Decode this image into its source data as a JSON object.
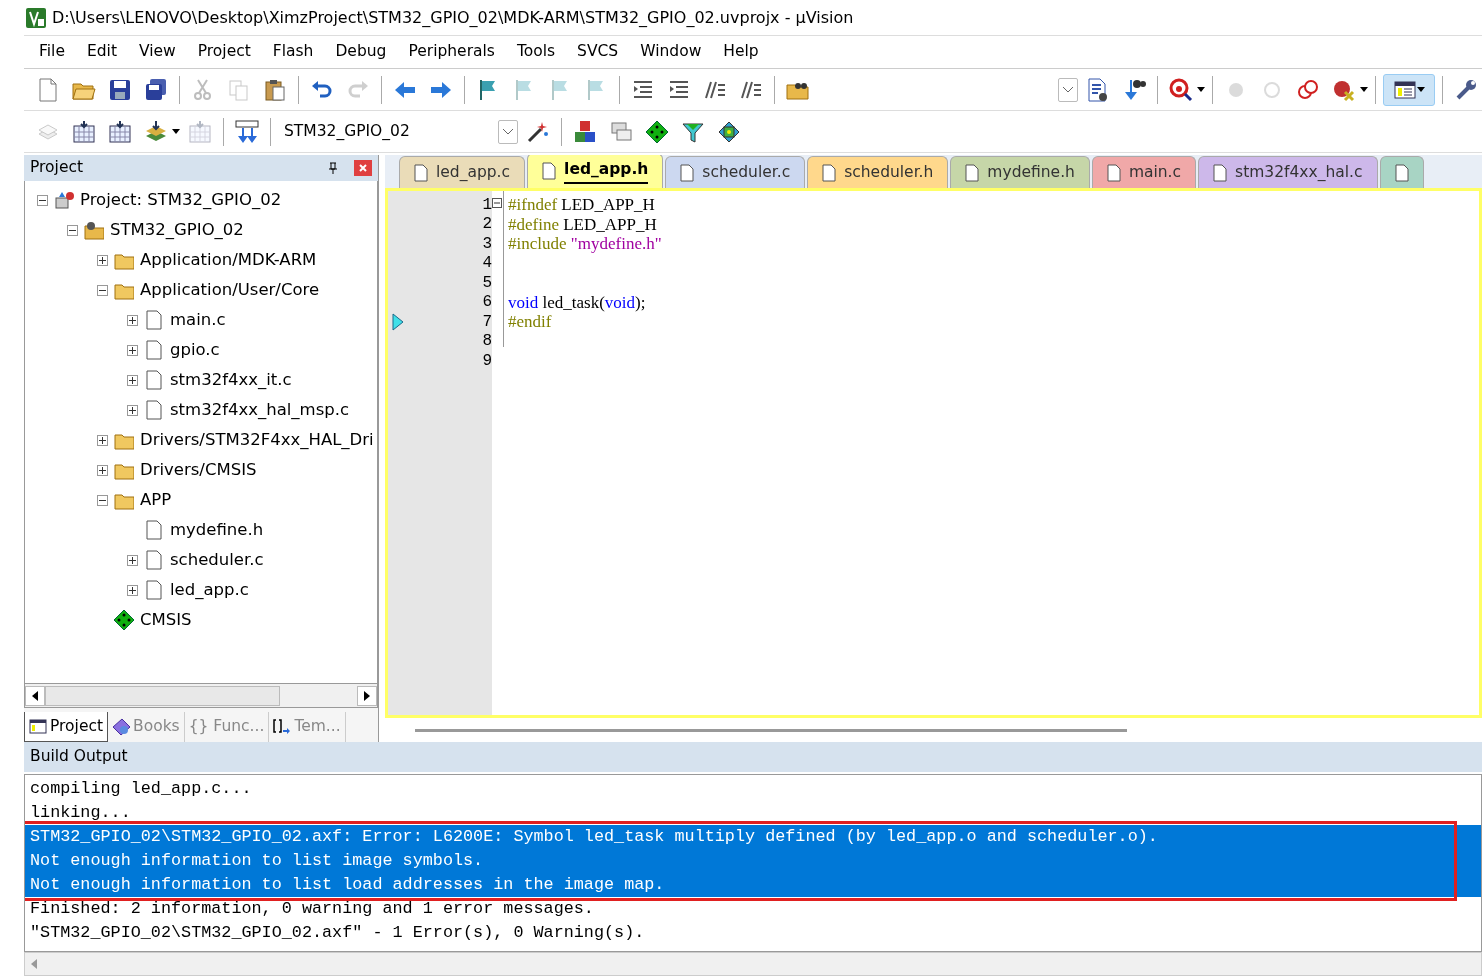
{
  "window": {
    "title": "D:\\Users\\LENOVO\\Desktop\\XimzProject\\STM32_GPIO_02\\MDK-ARM\\STM32_GPIO_02.uvprojx - µVision"
  },
  "menu": [
    "File",
    "Edit",
    "View",
    "Project",
    "Flash",
    "Debug",
    "Peripherals",
    "Tools",
    "SVCS",
    "Window",
    "Help"
  ],
  "toolbar_1": [
    {
      "kind": "new",
      "disabled": false
    },
    {
      "kind": "open",
      "disabled": false
    },
    {
      "kind": "save",
      "disabled": false
    },
    {
      "kind": "saveall",
      "disabled": false
    },
    {
      "kind": "sep"
    },
    {
      "kind": "cut",
      "disabled": true
    },
    {
      "kind": "copy",
      "disabled": true
    },
    {
      "kind": "paste",
      "disabled": false
    },
    {
      "kind": "sep"
    },
    {
      "kind": "undo",
      "disabled": false
    },
    {
      "kind": "redo",
      "disabled": true
    },
    {
      "kind": "sep"
    },
    {
      "kind": "back",
      "disabled": false
    },
    {
      "kind": "forward",
      "disabled": false
    },
    {
      "kind": "sep"
    },
    {
      "kind": "flag",
      "disabled": false
    },
    {
      "kind": "flag",
      "disabled": true
    },
    {
      "kind": "flag",
      "disabled": true
    },
    {
      "kind": "flag",
      "disabled": true
    },
    {
      "kind": "sep"
    },
    {
      "kind": "indent",
      "disabled": false
    },
    {
      "kind": "indent",
      "disabled": false
    },
    {
      "kind": "comment",
      "disabled": false
    },
    {
      "kind": "comment",
      "disabled": false
    },
    {
      "kind": "sep"
    },
    {
      "kind": "findfolder",
      "disabled": false
    },
    {
      "kind": "spacer"
    },
    {
      "kind": "combo"
    },
    {
      "kind": "finddoc",
      "disabled": false
    },
    {
      "kind": "binoculars",
      "disabled": false
    },
    {
      "kind": "sep"
    },
    {
      "kind": "debug",
      "disabled": false
    },
    {
      "kind": "caret"
    },
    {
      "kind": "sep"
    },
    {
      "kind": "dot",
      "disabled": true
    },
    {
      "kind": "ring",
      "disabled": true
    },
    {
      "kind": "rings",
      "disabled": false
    },
    {
      "kind": "killbp",
      "disabled": false
    },
    {
      "kind": "caret"
    },
    {
      "kind": "sep"
    },
    {
      "kind": "window",
      "disabled": false,
      "selected": true
    },
    {
      "kind": "sep"
    },
    {
      "kind": "wrench",
      "disabled": false
    }
  ],
  "toolbar_2": [
    {
      "kind": "translate",
      "disabled": true
    },
    {
      "kind": "build",
      "disabled": false
    },
    {
      "kind": "build",
      "disabled": false
    },
    {
      "kind": "batch",
      "disabled": false
    },
    {
      "kind": "caret"
    },
    {
      "kind": "build",
      "disabled": true
    },
    {
      "kind": "sep"
    },
    {
      "kind": "load",
      "disabled": false
    },
    {
      "kind": "sep"
    },
    {
      "kind": "target"
    },
    {
      "kind": "options",
      "disabled": false
    },
    {
      "kind": "sep"
    },
    {
      "kind": "blocks",
      "disabled": false
    },
    {
      "kind": "stack",
      "disabled": false
    },
    {
      "kind": "diamond",
      "disabled": false
    },
    {
      "kind": "funnel",
      "disabled": false
    },
    {
      "kind": "pack",
      "disabled": false
    }
  ],
  "target_select": {
    "value": "STM32_GPIO_02"
  },
  "project_panel": {
    "title": "Project",
    "tree": [
      {
        "kind": "project",
        "label": "Project: STM32_GPIO_02",
        "expanded": true,
        "children": [
          {
            "kind": "target",
            "label": "STM32_GPIO_02",
            "expanded": true,
            "children": [
              {
                "kind": "group",
                "label": "Application/MDK-ARM",
                "expanded": false
              },
              {
                "kind": "group",
                "label": "Application/User/Core",
                "expanded": true,
                "children": [
                  {
                    "kind": "file",
                    "label": "main.c",
                    "expanded": false
                  },
                  {
                    "kind": "file",
                    "label": "gpio.c",
                    "expanded": false
                  },
                  {
                    "kind": "file",
                    "label": "stm32f4xx_it.c",
                    "expanded": false
                  },
                  {
                    "kind": "file",
                    "label": "stm32f4xx_hal_msp.c",
                    "expanded": false
                  }
                ]
              },
              {
                "kind": "group",
                "label": "Drivers/STM32F4xx_HAL_Dri",
                "expanded": false
              },
              {
                "kind": "group",
                "label": "Drivers/CMSIS",
                "expanded": false
              },
              {
                "kind": "group",
                "label": "APP",
                "expanded": true,
                "children": [
                  {
                    "kind": "file",
                    "label": "mydefine.h"
                  },
                  {
                    "kind": "file",
                    "label": "scheduler.c",
                    "expanded": false
                  },
                  {
                    "kind": "file",
                    "label": "led_app.c",
                    "expanded": false
                  }
                ]
              },
              {
                "kind": "cmsis",
                "label": "CMSIS"
              }
            ]
          }
        ]
      }
    ],
    "tabs": [
      {
        "kind": "project",
        "label": "Project",
        "selected": true
      },
      {
        "kind": "books",
        "label": "Books",
        "selected": false
      },
      {
        "kind": "func",
        "label": "{} Func...",
        "selected": false
      },
      {
        "kind": "templ",
        "label": "Tem...",
        "selected": false
      }
    ]
  },
  "editor": {
    "tabs": [
      {
        "label": "led_app.c",
        "selected": false,
        "color": "#eadcb8"
      },
      {
        "label": "led_app.h",
        "selected": true,
        "color": "#ffff99"
      },
      {
        "label": "scheduler.c",
        "selected": false,
        "color": "#ccd8f0"
      },
      {
        "label": "scheduler.h",
        "selected": false,
        "color": "#ffd88c"
      },
      {
        "label": "mydefine.h",
        "selected": false,
        "color": "#c6d6a8"
      },
      {
        "label": "main.c",
        "selected": false,
        "color": "#f0a8a8"
      },
      {
        "label": "stm32f4xx_hal.c",
        "selected": false,
        "color": "#cdb8ea"
      },
      {
        "selected": false,
        "color": "#a8d4c4"
      }
    ],
    "lines": [
      {
        "number": "1",
        "marked": false,
        "fold": true,
        "tokens": [
          {
            "kind": "directive",
            "text": "#ifndef"
          },
          {
            "kind": "plain",
            "text": " LED_APP_H"
          }
        ]
      },
      {
        "number": "2",
        "marked": false,
        "fold": false,
        "tokens": [
          {
            "kind": "directive",
            "text": "#define"
          },
          {
            "kind": "plain",
            "text": " LED_APP_H"
          }
        ]
      },
      {
        "number": "3",
        "marked": false,
        "fold": false,
        "tokens": [
          {
            "kind": "directive",
            "text": "#include"
          },
          {
            "kind": "string",
            "text": " \"mydefine.h\""
          }
        ]
      },
      {
        "number": "4",
        "marked": false,
        "fold": false
      },
      {
        "number": "5",
        "marked": false,
        "fold": false
      },
      {
        "number": "6",
        "marked": false,
        "fold": false,
        "tokens": [
          {
            "kind": "keyword",
            "text": "void"
          },
          {
            "kind": "plain",
            "text": " led_task("
          },
          {
            "kind": "keyword",
            "text": "void"
          },
          {
            "kind": "plain",
            "text": ");"
          }
        ]
      },
      {
        "number": "7",
        "marked": true,
        "fold": false,
        "tokens": [
          {
            "kind": "directive",
            "text": "#endif"
          }
        ]
      },
      {
        "number": "8",
        "marked": false,
        "fold": false
      },
      {
        "number": "9",
        "marked": false,
        "fold": false
      }
    ]
  },
  "build_output": {
    "title": "Build Output",
    "lines": [
      {
        "text": "compiling led_app.c...",
        "selected": false
      },
      {
        "text": "linking...",
        "selected": false
      },
      {
        "text": "STM32_GPIO_02\\STM32_GPIO_02.axf: Error: L6200E: Symbol led_task multiply defined (by led_app.o and scheduler.o).",
        "selected": true
      },
      {
        "text": "Not enough information to list image symbols.",
        "selected": true
      },
      {
        "text": "Not enough information to list load addresses in the image map.",
        "selected": true
      },
      {
        "text": "Finished: 2 information, 0 warning and 1 error messages.",
        "selected": false
      },
      {
        "text": "\"STM32_GPIO_02\\STM32_GPIO_02.axf\" - 1 Error(s), 0 Warning(s).",
        "selected": false
      }
    ],
    "annotation_frame": true
  }
}
